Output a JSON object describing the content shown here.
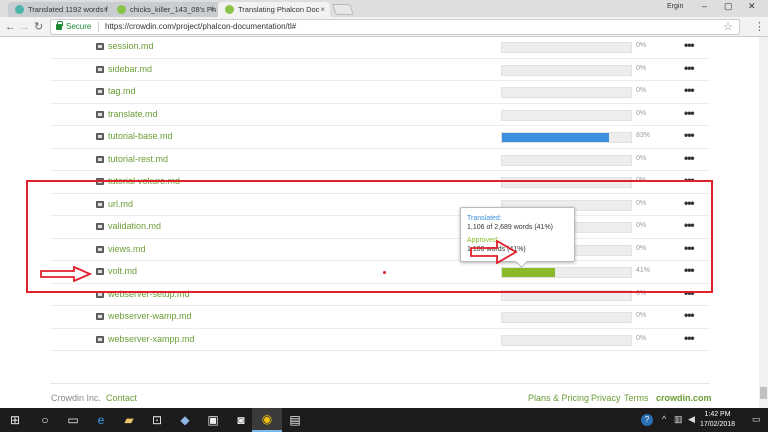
{
  "browser": {
    "tabs": [
      {
        "title": "Translated 1192 words f",
        "favicon_color": "#4db6ac",
        "active": false
      },
      {
        "title": "chicks_killer_143_08's Ph",
        "favicon_color": "#8bc34a",
        "active": false
      },
      {
        "title": "Translating Phalcon Doc",
        "favicon_color": "#8bc34a",
        "active": true
      }
    ],
    "user_label": "Ergin",
    "secure_label": "Secure",
    "url": "https://crowdin.com/project/phalcon-documentation/tl#"
  },
  "files": [
    {
      "name": "session.md",
      "progress": 0,
      "percent": "0%"
    },
    {
      "name": "sidebar.md",
      "progress": 0,
      "percent": "0%"
    },
    {
      "name": "tag.md",
      "progress": 0,
      "percent": "0%"
    },
    {
      "name": "translate.md",
      "progress": 0,
      "percent": "0%"
    },
    {
      "name": "tutorial-base.md",
      "progress": 0.83,
      "percent": "83%",
      "color": "#3b8fdc"
    },
    {
      "name": "tutorial-rest.md",
      "progress": 0,
      "percent": "0%"
    },
    {
      "name": "tutorial-vokuro.md",
      "progress": 0,
      "percent": "0%"
    },
    {
      "name": "url.md",
      "progress": 0,
      "percent": "0%"
    },
    {
      "name": "validation.md",
      "progress": 0,
      "percent": "0%"
    },
    {
      "name": "views.md",
      "progress": 0,
      "percent": "0%"
    },
    {
      "name": "volt.md",
      "progress": 0.41,
      "percent": "41%",
      "color": "#8cb92a"
    },
    {
      "name": "webserver-setup.md",
      "progress": 0,
      "percent": "0%"
    },
    {
      "name": "webserver-wamp.md",
      "progress": 0,
      "percent": "0%"
    },
    {
      "name": "webserver-xampp.md",
      "progress": 0,
      "percent": "0%"
    }
  ],
  "tooltip": {
    "translated_label": "Translated:",
    "translated_value": "1,106 of 2,689 words (41%)",
    "approved_label": "Approved:",
    "approved_value": "1,106 words (41%)",
    "translated_color": "#3b8fdc",
    "approved_color": "#8cb92a"
  },
  "footer": {
    "company": "Crowdin Inc.",
    "contact": "Contact",
    "plans": "Plans & Pricing",
    "privacy": "Privacy",
    "terms": "Terms",
    "brand": "crowdin.com"
  },
  "taskbar": {
    "time": "1:42 PM",
    "date": "17/02/2018"
  },
  "colors": {
    "accent_green": "#6b9e36",
    "annotation_red": "#e0202a"
  }
}
